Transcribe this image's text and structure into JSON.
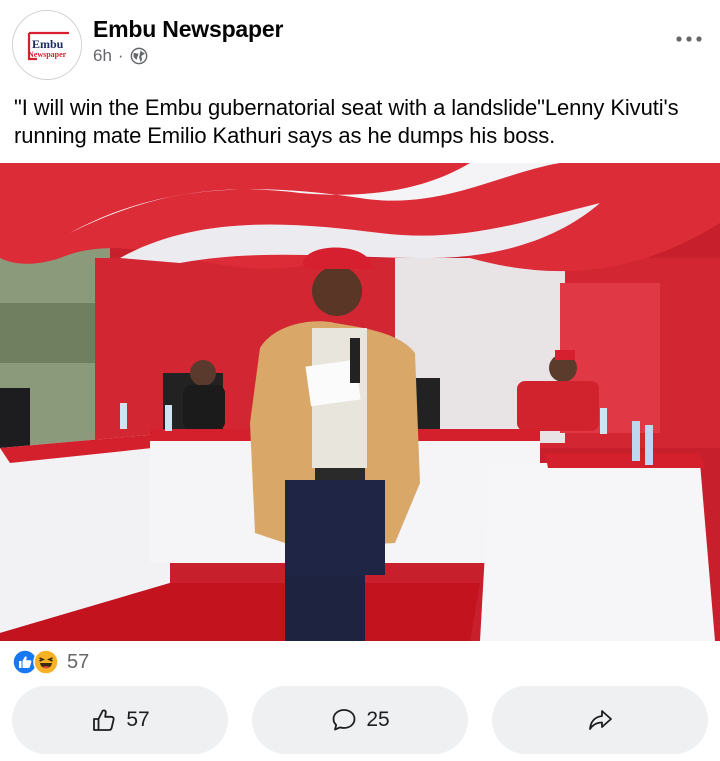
{
  "post": {
    "page_name": "Embu Newspaper",
    "time": "6h",
    "separator": "·",
    "audience_icon": "globe-icon",
    "caption": "\"I will win the Embu gubernatorial seat with a landslide\"Lenny Kivuti's running mate Emilio Kathuri says as he dumps his boss.",
    "logo": {
      "line1": "Embu",
      "line2": "Newspaper"
    }
  },
  "reactions": {
    "icons": [
      "like-icon",
      "haha-icon"
    ],
    "count": "57"
  },
  "actions": {
    "like_count": "57",
    "comment_count": "25"
  },
  "colors": {
    "accent_blue": "#1877f2",
    "haha_yellow": "#f7b125",
    "secondary_text": "#65676b",
    "button_bg": "#eff0f2",
    "logo_red": "#d6202f"
  }
}
